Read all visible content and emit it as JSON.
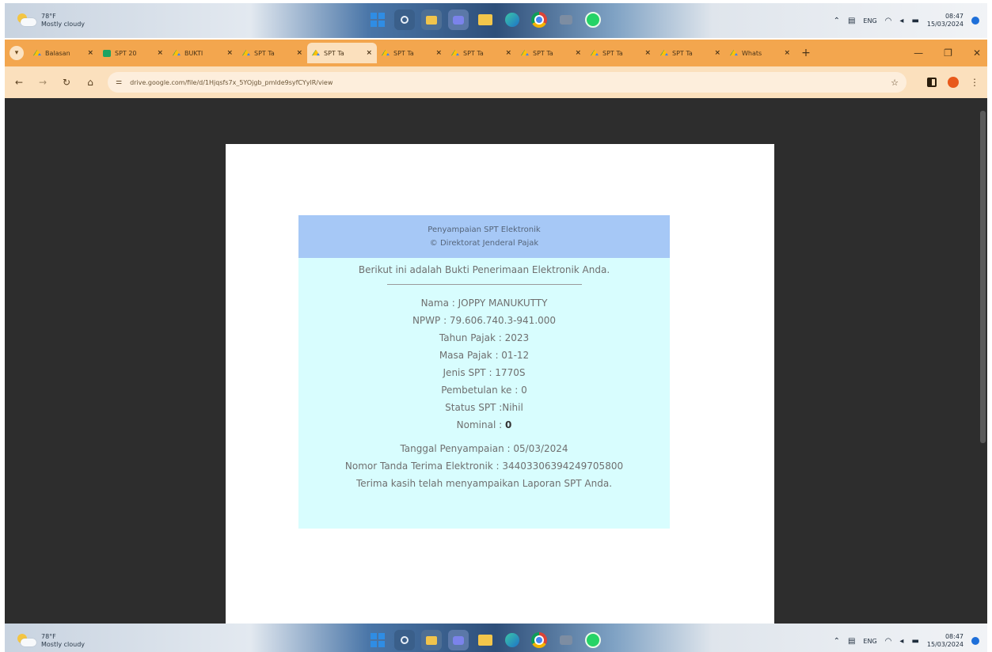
{
  "taskbar": {
    "weather_temp": "78°F",
    "weather_desc": "Mostly cloudy",
    "tray_lang": "ENG",
    "clock_time": "08:47",
    "clock_date": "15/03/2024"
  },
  "browser": {
    "tabs": [
      {
        "label": "Balasan",
        "icon": "drive-icon"
      },
      {
        "label": "SPT 20",
        "icon": "sheets-icon"
      },
      {
        "label": "BUKTI",
        "icon": "drive-icon"
      },
      {
        "label": "SPT Ta",
        "icon": "drive-icon"
      },
      {
        "label": "SPT Ta",
        "icon": "drive-icon",
        "active": true
      },
      {
        "label": "SPT Ta",
        "icon": "drive-icon"
      },
      {
        "label": "SPT Ta",
        "icon": "drive-icon"
      },
      {
        "label": "SPT Ta",
        "icon": "drive-icon"
      },
      {
        "label": "SPT Ta",
        "icon": "drive-icon"
      },
      {
        "label": "SPT Ta",
        "icon": "drive-icon"
      },
      {
        "label": "Whats",
        "icon": "drive-icon"
      }
    ],
    "tab_close": "×",
    "new_tab": "+",
    "url": "drive.google.com/file/d/1Hjqsfs7x_5YOjgb_pmlde9syfCYylR/view",
    "accent_color": "#f3a64e"
  },
  "receipt": {
    "header_line1": "Penyampaian SPT Elektronik",
    "header_line2": "© Direktorat Jenderal Pajak",
    "intro": "Berikut ini adalah Bukti Penerimaan Elektronik Anda.",
    "nama": "Nama : JOPPY MANUKUTTY",
    "npwp": "NPWP : 79.606.740.3-941.000",
    "tahun_pajak": "Tahun Pajak : 2023",
    "masa_pajak": "Masa Pajak : 01-12",
    "jenis_spt": "Jenis SPT : 1770S",
    "pembetulan": "Pembetulan ke : 0",
    "status_spt": "Status SPT :Nihil",
    "nominal_label": "Nominal : ",
    "nominal_value": "0",
    "tanggal": "Tanggal Penyampaian : 05/03/2024",
    "nomor_tanda_terima": "Nomor Tanda Terima Elektronik : 344033063942497058​00",
    "closing": "Terima kasih telah menyampaikan Laporan SPT Anda.",
    "header_color": "#a6c8f6",
    "body_color": "#d8fdfe"
  }
}
